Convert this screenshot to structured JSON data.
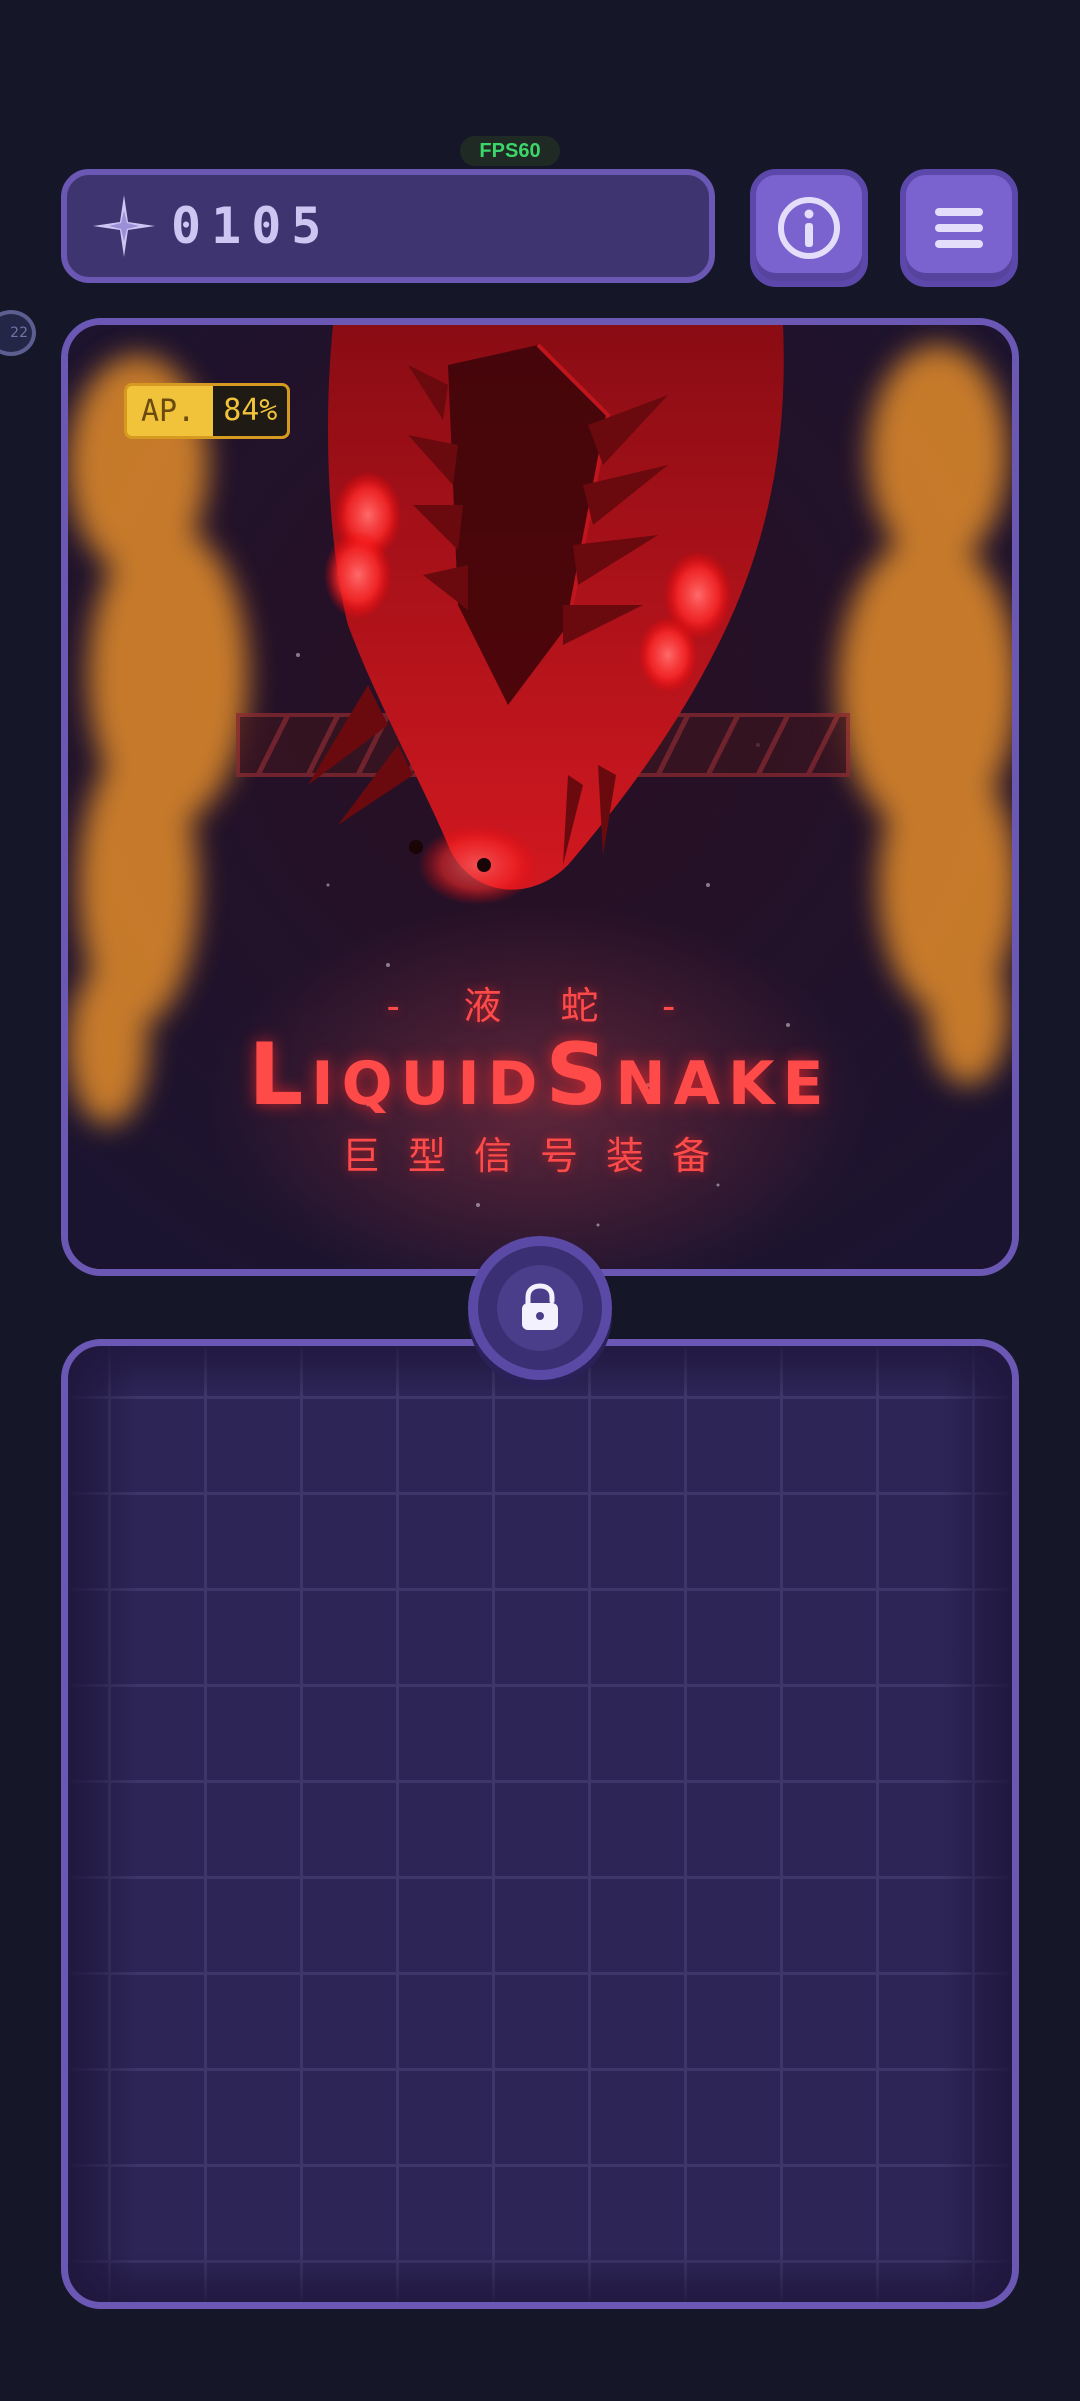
{
  "hud": {
    "fps_label": "FPS60",
    "score": "0105",
    "score_icon": "compass-star-icon",
    "info_icon": "info-icon",
    "menu_icon": "hamburger-menu-icon",
    "side_indicator": "22"
  },
  "art_card": {
    "ap_label": "AP.",
    "ap_value": "84%",
    "subtitle_top": "- 液 蛇 -",
    "title": "LiquidSnake",
    "subtitle_bottom": "巨型信号装备"
  },
  "lock_button": {
    "icon": "unlocked-padlock-icon"
  },
  "colors": {
    "background": "#161629",
    "panel_border": "#6a58b4",
    "button_fill": "#7a63cf",
    "title_red": "#ff4a4a",
    "badge_yellow": "#f0c33a",
    "fps_green": "#3dd56a"
  }
}
